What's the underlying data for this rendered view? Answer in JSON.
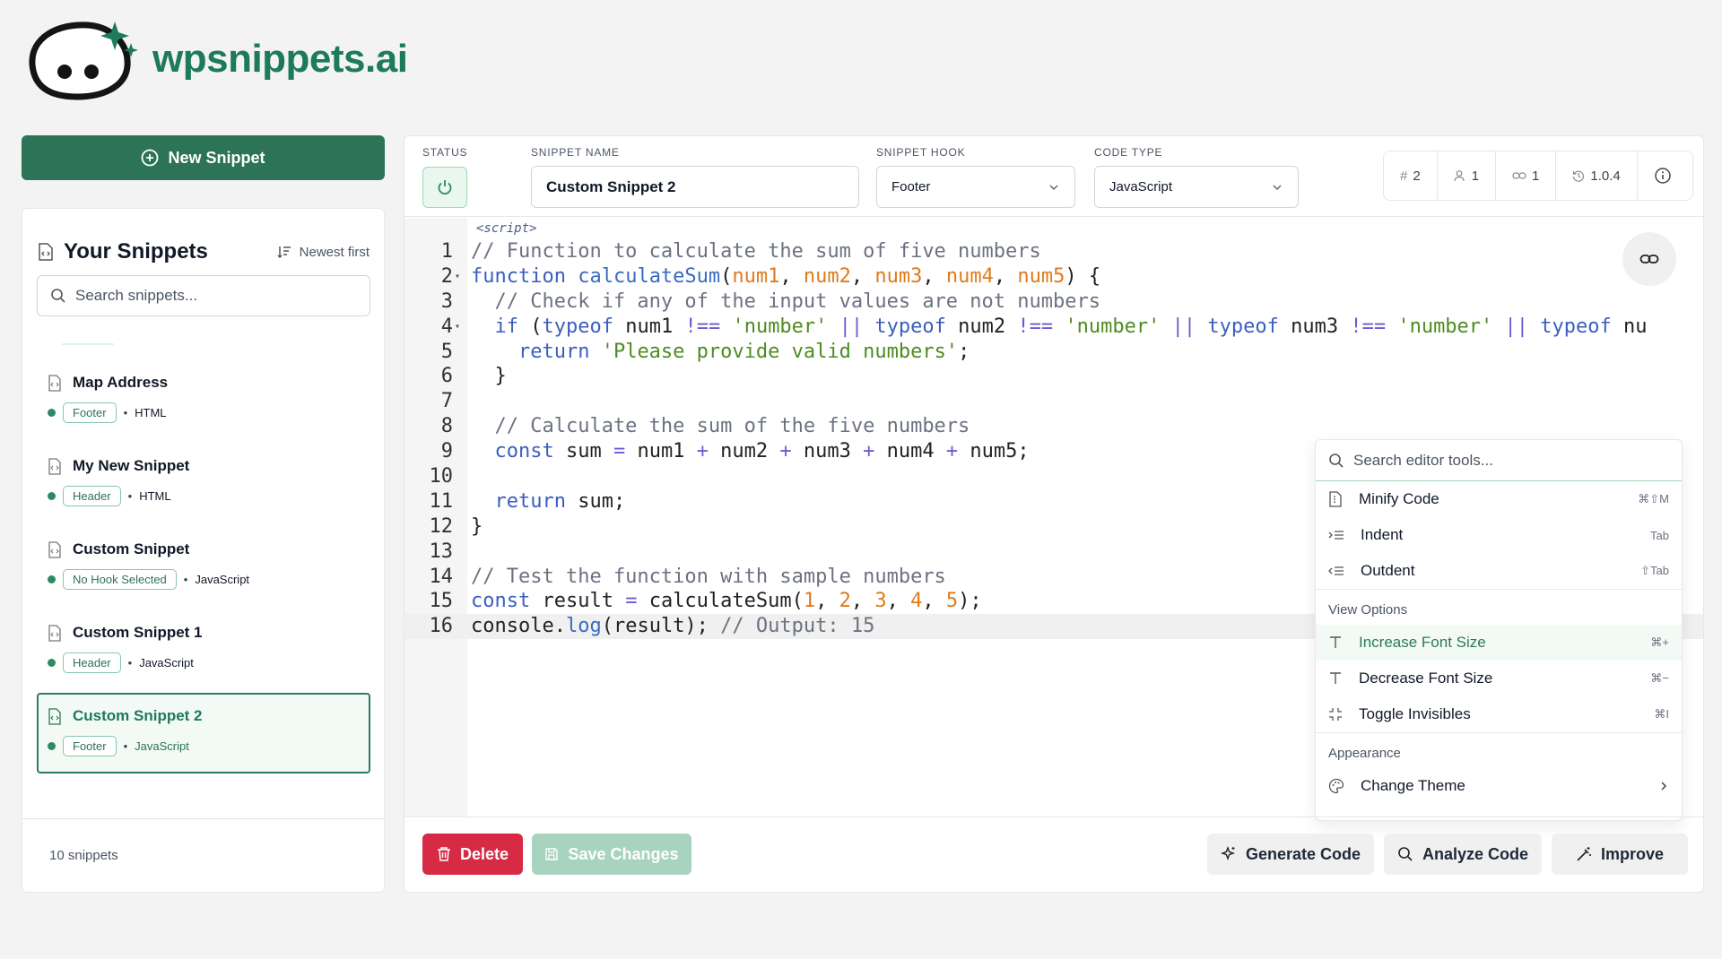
{
  "brand": {
    "name": "wpsnippets.ai"
  },
  "new_snippet_label": "New Snippet",
  "sidebar": {
    "title": "Your Snippets",
    "sort_label": "Newest first",
    "search_placeholder": "Search snippets...",
    "items": [
      {
        "name": "Map Address",
        "hook": "Footer",
        "type": "HTML"
      },
      {
        "name": "My New Snippet",
        "hook": "Header",
        "type": "HTML"
      },
      {
        "name": "Custom Snippet",
        "hook": "No Hook Selected",
        "type": "JavaScript"
      },
      {
        "name": "Custom Snippet 1",
        "hook": "Header",
        "type": "JavaScript"
      },
      {
        "name": "Custom Snippet 2",
        "hook": "Footer",
        "type": "JavaScript",
        "active": true
      }
    ],
    "count": "10 snippets"
  },
  "toolbar": {
    "status_label": "STATUS",
    "name_label": "SNIPPET NAME",
    "name_value": "Custom Snippet 2",
    "hook_label": "SNIPPET HOOK",
    "hook_value": "Footer",
    "type_label": "CODE TYPE",
    "type_value": "JavaScript",
    "stats": {
      "hash": "2",
      "users": "1",
      "links": "1",
      "version": "1.0.4"
    }
  },
  "editor": {
    "script_tag": "<script>",
    "lines": [
      "// Function to calculate the sum of five numbers",
      "function calculateSum(num1, num2, num3, num4, num5) {",
      "  // Check if any of the input values are not numbers",
      "  if (typeof num1 !== 'number' || typeof num2 !== 'number' || typeof num3 !== 'number' || typeof nu",
      "    return 'Please provide valid numbers';",
      "  }",
      "",
      "  // Calculate the sum of the five numbers",
      "  const sum = num1 + num2 + num3 + num4 + num5;",
      "",
      "  return sum;",
      "}",
      "",
      "// Test the function with sample numbers",
      "const result = calculateSum(1, 2, 3, 4, 5);",
      "console.log(result); // Output: 15"
    ]
  },
  "tools_menu": {
    "search_placeholder": "Search editor tools...",
    "items": [
      {
        "label": "Minify Code",
        "shortcut": "⌘⇧M"
      },
      {
        "label": "Indent",
        "shortcut": "Tab"
      },
      {
        "label": "Outdent",
        "shortcut": "⇧Tab"
      }
    ],
    "view_section": "View Options",
    "view_items": [
      {
        "label": "Increase Font Size",
        "shortcut": "⌘+"
      },
      {
        "label": "Decrease Font Size",
        "shortcut": "⌘−"
      },
      {
        "label": "Toggle Invisibles",
        "shortcut": "⌘I"
      }
    ],
    "appearance_section": "Appearance",
    "theme_label": "Change Theme"
  },
  "actions": {
    "delete": "Delete",
    "save": "Save Changes",
    "generate": "Generate Code",
    "analyze": "Analyze Code",
    "improve": "Improve"
  },
  "colors": {
    "brand": "#2c7358",
    "danger": "#d62a45",
    "accent_text": "#1e7a5c"
  }
}
